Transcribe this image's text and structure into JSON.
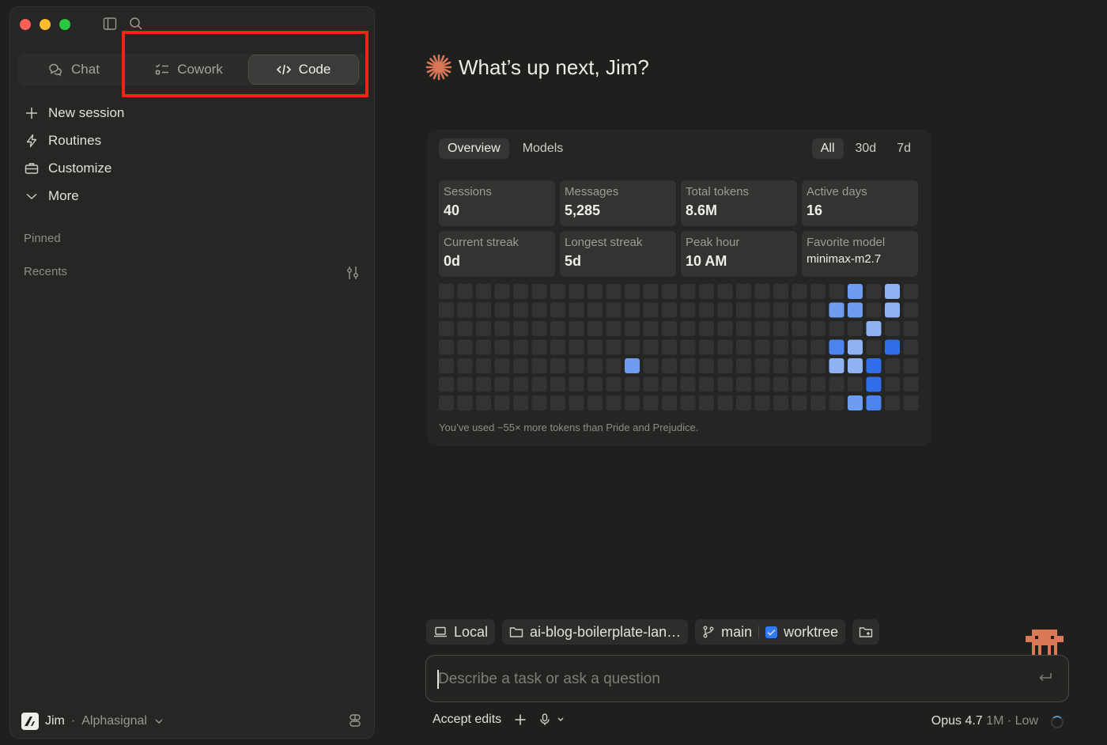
{
  "sidebar": {
    "modes": [
      {
        "label": "Chat",
        "icon": "chat-icon",
        "active": false
      },
      {
        "label": "Cowork",
        "icon": "checklist-icon",
        "active": false
      },
      {
        "label": "Code",
        "icon": "code-icon",
        "active": true
      }
    ],
    "nav": [
      {
        "label": "New session",
        "icon": "plus-icon"
      },
      {
        "label": "Routines",
        "icon": "bolt-icon"
      },
      {
        "label": "Customize",
        "icon": "briefcase-icon"
      },
      {
        "label": "More",
        "icon": "chevron-down-icon"
      }
    ],
    "pinned_label": "Pinned",
    "recents_label": "Recents",
    "user": {
      "name": "Jim",
      "separator": "·",
      "org": "Alphasignal"
    }
  },
  "main": {
    "greeting": "What’s up next, Jim?",
    "tabs": [
      {
        "label": "Overview",
        "active": true
      },
      {
        "label": "Models",
        "active": false
      }
    ],
    "ranges": [
      {
        "label": "All",
        "active": true
      },
      {
        "label": "30d",
        "active": false
      },
      {
        "label": "7d",
        "active": false
      }
    ],
    "stats": [
      {
        "label": "Sessions",
        "value": "40"
      },
      {
        "label": "Messages",
        "value": "5,285"
      },
      {
        "label": "Total tokens",
        "value": "8.6M"
      },
      {
        "label": "Active days",
        "value": "16"
      },
      {
        "label": "Current streak",
        "value": "0d"
      },
      {
        "label": "Longest streak",
        "value": "5d"
      },
      {
        "label": "Peak hour",
        "value": "10 AM"
      },
      {
        "label": "Favorite model",
        "value": "minimax-m2.7"
      }
    ],
    "heatmap": {
      "columns": 26,
      "rows": 7,
      "active_cells": [
        {
          "col": 22,
          "row": 0,
          "level": 2
        },
        {
          "col": 24,
          "row": 0,
          "level": 1
        },
        {
          "col": 21,
          "row": 1,
          "level": 2
        },
        {
          "col": 22,
          "row": 1,
          "level": 2
        },
        {
          "col": 24,
          "row": 1,
          "level": 1
        },
        {
          "col": 23,
          "row": 2,
          "level": 1
        },
        {
          "col": 21,
          "row": 3,
          "level": 3
        },
        {
          "col": 22,
          "row": 3,
          "level": 1
        },
        {
          "col": 24,
          "row": 3,
          "level": 4
        },
        {
          "col": 10,
          "row": 4,
          "level": 2
        },
        {
          "col": 21,
          "row": 4,
          "level": 1
        },
        {
          "col": 22,
          "row": 4,
          "level": 1
        },
        {
          "col": 23,
          "row": 4,
          "level": 4
        },
        {
          "col": 23,
          "row": 5,
          "level": 4
        },
        {
          "col": 22,
          "row": 6,
          "level": 2
        },
        {
          "col": 23,
          "row": 6,
          "level": 3
        }
      ],
      "colors": {
        "empty": "#333332",
        "level1": "#8fb2f2",
        "level2": "#6e9df0",
        "level3": "#4b84ee",
        "level4": "#2f6ee6"
      }
    },
    "fun_fact": "You’ve used ~55× more tokens than Pride and Prejudice."
  },
  "composer": {
    "chips": {
      "env": "Local",
      "folder": "ai-blog-boilerplate-lan…",
      "branch": "main",
      "worktree": "worktree"
    },
    "placeholder": "Describe a task or ask a question",
    "footer": {
      "mode": "Accept edits"
    },
    "model": {
      "name": "Opus 4.7",
      "context": "1M",
      "separator": "·",
      "effort": "Low"
    }
  },
  "colors": {
    "highlight": "#ee2416",
    "accent": "#d97757",
    "checkbox": "#2f7bff"
  }
}
